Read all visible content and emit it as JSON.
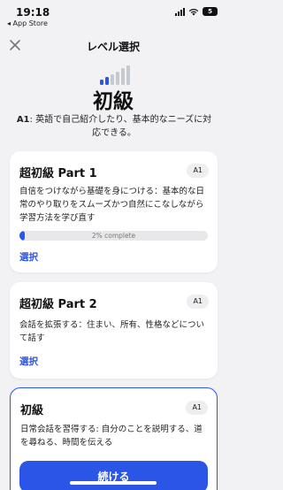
{
  "status": {
    "time": "19:18",
    "back_app": "◂ App Store",
    "battery": "5"
  },
  "nav": {
    "title": "レベル選択"
  },
  "level": {
    "title": "初級",
    "code": "A1",
    "description": ": 英語で自己紹介したり、基本的なニーズに対応できる。"
  },
  "colors": {
    "accent": "#2b55e6",
    "background": "#f2f2f4"
  },
  "cards": [
    {
      "title": "超初級 Part 1",
      "badge": "A1",
      "description": "自信をつけながら基礎を身につける：基本的な日常のやり取りをスムーズかつ自然にこなしながら学習方法を学び直す",
      "progress_percent": 2,
      "progress_label": "2% complete",
      "action": "選択"
    },
    {
      "title": "超初級 Part 2",
      "badge": "A1",
      "description": "会話を拡張する：住まい、所有、性格などについて話す",
      "action": "選択"
    },
    {
      "title": "初級",
      "badge": "A1",
      "description": "日常会話を習得する: 自分のことを説明する、道を尋ねる、時間を伝える",
      "action": "続ける"
    }
  ]
}
